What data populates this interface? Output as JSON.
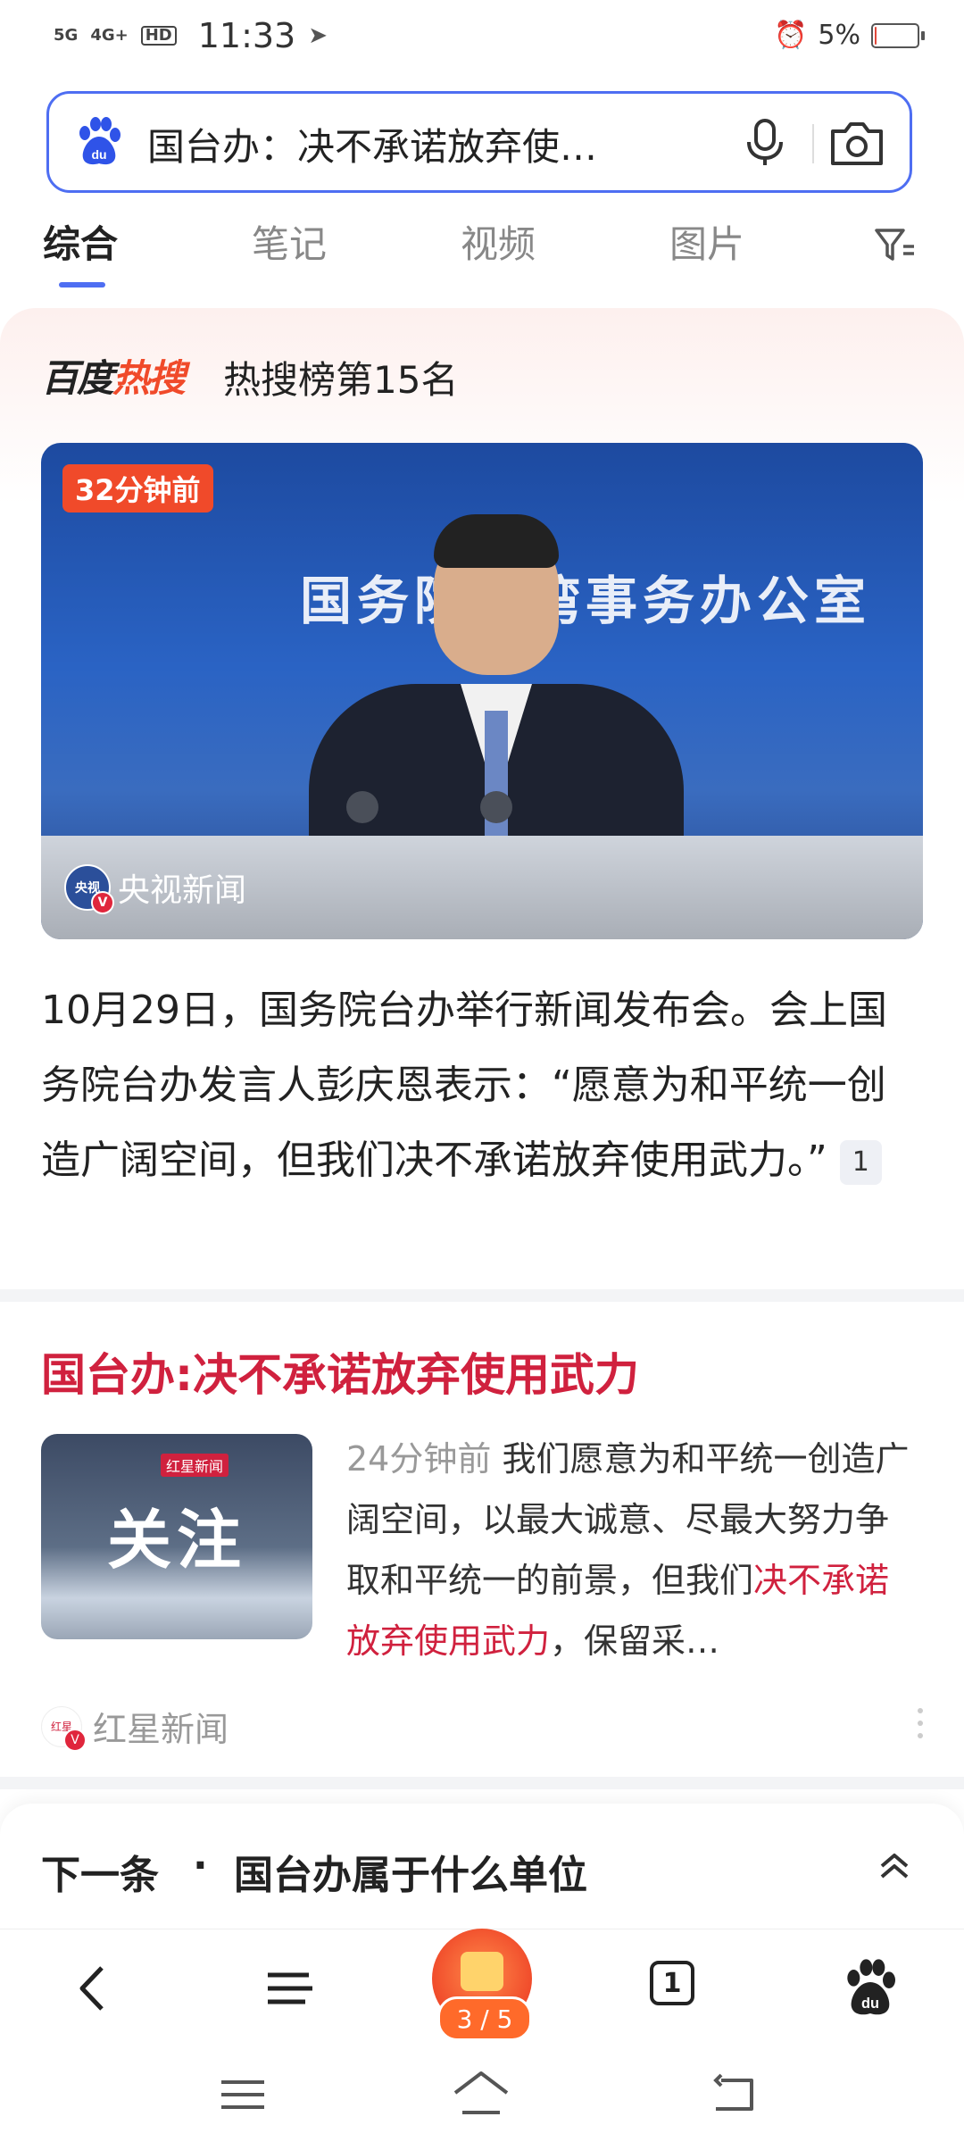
{
  "status_bar": {
    "signal1": "5G",
    "signal2": "4G+",
    "hd": "HD",
    "time": "11:33",
    "battery_text": "5%",
    "battery_level": 0.05
  },
  "search": {
    "query": "国台办：决不承诺放弃使…"
  },
  "tabs": [
    "综合",
    "笔记",
    "视频",
    "图片"
  ],
  "hot": {
    "logo_black": "百度",
    "logo_red": "热搜",
    "rank_text": "热搜榜第15名",
    "video_badge": "32分钟前",
    "video_banner": "国务院台湾事务办公室",
    "video_source": "央视新闻",
    "description": "10月29日，国务院台办举行新闻发布会。会上国务院台办发言人彭庆恩表示：“愿意为和平统一创造广阔空间，但我们决不承诺放弃使用武力。”",
    "cite": "1"
  },
  "article": {
    "title": "国台办:决不承诺放弃使用武力",
    "thumb_tag": "红星新闻",
    "thumb_text": "关注",
    "time": "24分钟前",
    "snippet_a": "我们愿意为和平统一创造广阔空间，以最大诚意、尽最大努力争取和平统一的前景，但我们",
    "snippet_red": "决不承诺放弃使用武力",
    "snippet_b": "，保留采…",
    "source": "红星新闻"
  },
  "next": {
    "label": "下一条",
    "dot": "·",
    "title": "国台办属于什么单位"
  },
  "toolbar": {
    "reward_progress": "3 / 5",
    "tab_count": "1"
  },
  "colors": {
    "accent": "#4e6ef2",
    "hot_red": "#f04a2a",
    "title_red": "#d0213e"
  }
}
